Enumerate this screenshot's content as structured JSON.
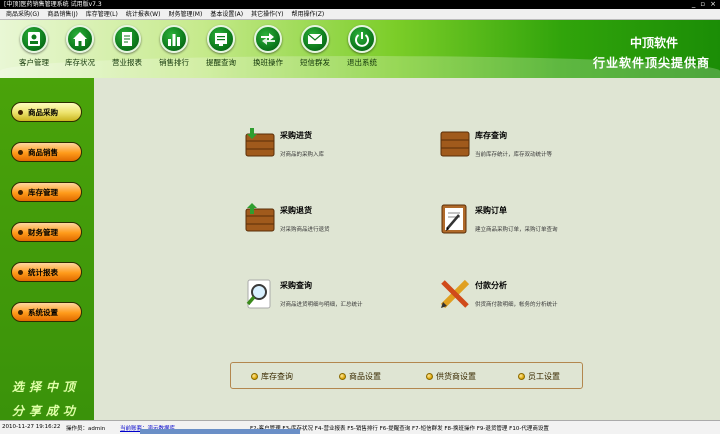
{
  "window": {
    "title": "[中顶]医药销售管理系统 试用版v7.3",
    "min": "_",
    "max": "▫",
    "close": "×"
  },
  "menu": [
    "商品采购(G)",
    "商品销售(J)",
    "库存管理(L)",
    "统计报表(W)",
    "财务管理(M)",
    "基本设置(A)",
    "其它操作(Y)",
    "帮用操作(Z)"
  ],
  "toolbar": [
    {
      "label": "客户管理",
      "icon": "customer-icon"
    },
    {
      "label": "库存状况",
      "icon": "home-icon"
    },
    {
      "label": "营业报表",
      "icon": "report-icon"
    },
    {
      "label": "销售排行",
      "icon": "bar-chart-icon"
    },
    {
      "label": "提醒查询",
      "icon": "reminder-icon"
    },
    {
      "label": "换班操作",
      "icon": "switch-icon"
    },
    {
      "label": "短信群发",
      "icon": "sms-icon"
    },
    {
      "label": "退出系统",
      "icon": "power-icon"
    }
  ],
  "brand": {
    "line1": "中顶软件",
    "line2": "行业软件顶尖提供商"
  },
  "sidebar": {
    "items": [
      "商品采购",
      "商品销售",
      "库存管理",
      "财务管理",
      "统计报表",
      "系统设置"
    ],
    "active_index": 0,
    "slogan1": "选择中顶",
    "slogan2": "分享成功"
  },
  "features": [
    {
      "title": "采购进货",
      "desc": "对商品的采购入库",
      "icon": "box-in-icon"
    },
    {
      "title": "库存查询",
      "desc": "当前库存统计，库存双动统计等",
      "icon": "box-icon"
    },
    {
      "title": "采购退货",
      "desc": "对采购商品进行退货",
      "icon": "box-out-icon"
    },
    {
      "title": "采购订单",
      "desc": "建立商品采购订单，采购订单查询",
      "icon": "order-pen-icon"
    },
    {
      "title": "采购查询",
      "desc": "对商品进货明细与明细，汇总统计",
      "icon": "magnifier-icon"
    },
    {
      "title": "付款分析",
      "desc": "供货商付款明细，帐务的分析统计",
      "icon": "pencil-ruler-icon"
    }
  ],
  "quick_links": [
    "库存查询",
    "商品设置",
    "供货商设置",
    "员工设置"
  ],
  "status": {
    "datetime": "2010-11-27 19:16:22",
    "operator": "操作员：admin",
    "account": "当前账套：演示数据库",
    "shortcuts": "F2-客户管理 F3-库存状况 F4-营业报表 F5-销售排行 F6-提醒查询 F7-短信群发 F8-换班操作 F9-退货管理 F10-代理商设置"
  },
  "colors": {
    "header_green": "#31a40b",
    "sidebar_green": "#4aa30a",
    "main_bg": "#dfe5d3",
    "active_button": "#ece26a",
    "normal_button": "#ff9b1a"
  }
}
